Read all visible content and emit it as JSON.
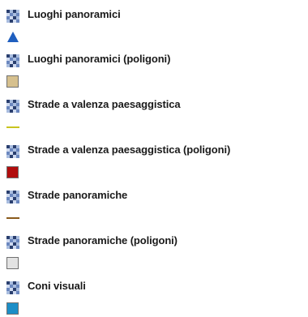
{
  "legend": {
    "layers": [
      {
        "label": "Luoghi panoramici",
        "symbol": "triangle",
        "color": "#1f5fbf",
        "layer_icon": "layer-grid-icon"
      },
      {
        "label": "Luoghi panoramici (poligoni)",
        "symbol": "box",
        "color": "#d6c08e",
        "layer_icon": "layer-grid-icon"
      },
      {
        "label": "Strade a valenza paesaggistica",
        "symbol": "line",
        "color": "#c9c41f",
        "layer_icon": "layer-grid-icon"
      },
      {
        "label": "Strade a valenza paesaggistica (poligoni)",
        "symbol": "box",
        "color": "#b10d0d",
        "layer_icon": "layer-grid-icon"
      },
      {
        "label": "Strade panoramiche",
        "symbol": "line",
        "color": "#8a5a1c",
        "layer_icon": "layer-grid-icon"
      },
      {
        "label": "Strade panoramiche (poligoni)",
        "symbol": "box",
        "color": "#e3e3e3",
        "layer_icon": "layer-grid-icon"
      },
      {
        "label": "Coni visuali",
        "symbol": "box",
        "color": "#1c8ec7",
        "layer_icon": "layer-grid-icon"
      }
    ]
  }
}
